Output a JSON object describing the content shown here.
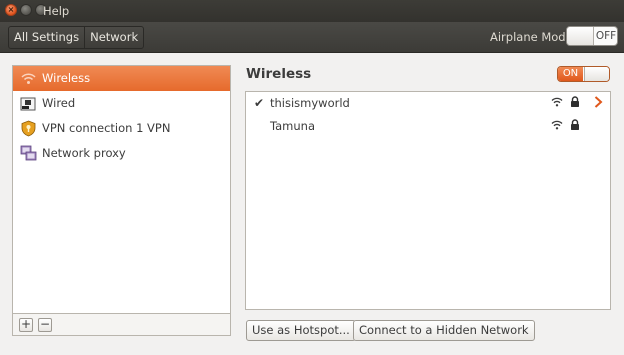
{
  "window": {
    "title": "Help",
    "buttons": {
      "close_icon": "close-icon",
      "minimize_icon": "minimize-icon",
      "maximize_icon": "maximize-icon"
    }
  },
  "toolbar": {
    "breadcrumbs": [
      "All Settings",
      "Network"
    ],
    "airplane_mode": {
      "label": "Airplane Mode",
      "state": "OFF"
    }
  },
  "connections": [
    {
      "label": "Wireless",
      "icon": "wireless-icon",
      "selected": true
    },
    {
      "label": "Wired",
      "icon": "wired-icon",
      "selected": false
    },
    {
      "label": "VPN connection 1 VPN",
      "icon": "vpn-icon",
      "selected": false
    },
    {
      "label": "Network proxy",
      "icon": "network-proxy-icon",
      "selected": false
    }
  ],
  "list_controls": {
    "add": "+",
    "remove": "−"
  },
  "wireless_panel": {
    "title": "Wireless",
    "toggle_state": "ON",
    "networks": [
      {
        "name": "thisismyworld",
        "connected": true,
        "check": "✔",
        "secured": true,
        "has_details": true
      },
      {
        "name": "Tamuna",
        "connected": false,
        "check": "",
        "secured": true,
        "has_details": false
      }
    ],
    "buttons": {
      "hotspot": "Use as Hotspot...",
      "hidden": "Connect to a Hidden Network"
    }
  },
  "colors": {
    "accent": "#e66a2c",
    "titlebar": "#3c3b37",
    "background": "#f2f1f0"
  }
}
